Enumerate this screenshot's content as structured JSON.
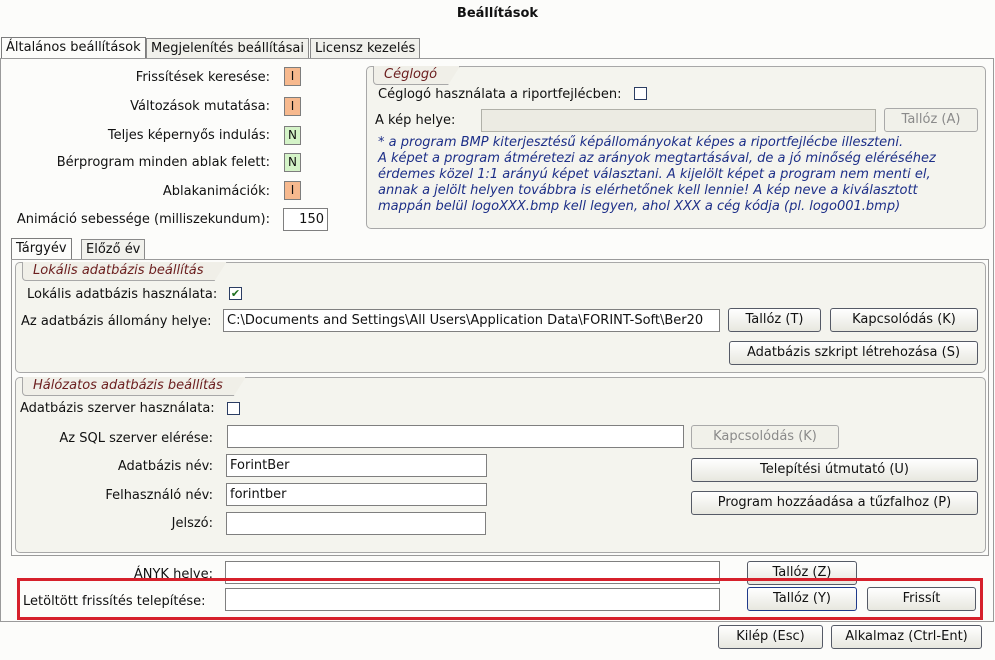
{
  "window": {
    "title": "Beállítások"
  },
  "tabs": [
    "Általános beállítások",
    "Megjelenítés beállításai",
    "Licensz kezelés"
  ],
  "general": {
    "rows": [
      {
        "label": "Frissítések keresése:",
        "value": "I"
      },
      {
        "label": "Változások mutatása:",
        "value": "I"
      },
      {
        "label": "Teljes képernyős indulás:",
        "value": "N"
      },
      {
        "label": "Bérprogram minden ablak felett:",
        "value": "N"
      },
      {
        "label": "Ablakanimációk:",
        "value": "I"
      }
    ],
    "animation_label": "Animáció sebessége (milliszekundum):",
    "animation_value": "150"
  },
  "ceglogo": {
    "legend": "Céglogó",
    "use_label": "Céglogó használata a riportfejlécben:",
    "use_checked": false,
    "path_label": "A kép helye:",
    "path_value": "",
    "browse_button": "Tallóz (A)",
    "note_lines": [
      "* a program BMP kiterjesztésű képállományokat képes a riportfejlécbe illeszteni.",
      "A képet a program átméretezi az arányok megtartásával, de a jó minőség eléréséhez",
      "érdemes közel 1:1 arányú képet választani. A kijelölt képet a program nem menti el,",
      "annak a jelölt helyen továbbra is elérhetőnek kell lennie! A kép neve a kiválasztott",
      "mappán belül logoXXX.bmp kell legyen, ahol XXX a cég kódja (pl. logo001.bmp)"
    ]
  },
  "year_tabs": [
    "Tárgyév",
    "Előző év"
  ],
  "local_db": {
    "legend": "Lokális adatbázis beállítás",
    "use_label": "Lokális adatbázis használata:",
    "use_checked": true,
    "path_label": "Az adatbázis állomány helye:",
    "path_value": "C:\\Documents and Settings\\All Users\\Application Data\\FORINT-Soft\\Ber20",
    "browse_button": "Tallóz (T)",
    "connect_button": "Kapcsolódás (K)",
    "script_button": "Adatbázis szkript létrehozása (S)"
  },
  "network_db": {
    "legend": "Hálózatos adatbázis beállítás",
    "use_label": "Adatbázis szerver használata:",
    "use_checked": false,
    "sql_label": "Az SQL szerver elérése:",
    "sql_value": "",
    "connect_button": "Kapcsolódás (K)",
    "dbname_label": "Adatbázis név:",
    "dbname_value": "ForintBer",
    "user_label": "Felhasználó név:",
    "user_value": "forintber",
    "password_label": "Jelszó:",
    "password_value": "",
    "install_guide_button": "Telepítési útmutató (U)",
    "firewall_button": "Program hozzáadása a tűzfalhoz (P)"
  },
  "anyk": {
    "label": "ÁNYK helye:",
    "value": "",
    "browse_button": "Tallóz (Z)"
  },
  "update": {
    "label": "Letöltött frissítés telepítése:",
    "value": "",
    "browse_button": "Tallóz (Y)",
    "refresh_button": "Frissít"
  },
  "footer": {
    "exit_button": "Kilép (Esc)",
    "apply_button": "Alkalmaz (Ctrl-Ent)"
  },
  "colors": {
    "flag_I": "#f7b98e",
    "flag_N": "#d4f3c7",
    "highlight": "#d6202b",
    "legend_text": "#6b1e1e",
    "note_text": "#1d2f88"
  }
}
